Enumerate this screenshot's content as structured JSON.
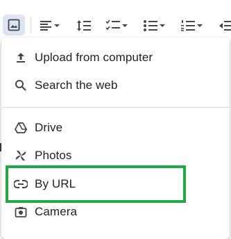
{
  "toolbar": {
    "items": [
      {
        "icon": "insert-image-icon"
      },
      {
        "icon": "align-left-icon"
      },
      {
        "icon": "line-spacing-icon"
      },
      {
        "icon": "checklist-icon"
      },
      {
        "icon": "bulleted-list-icon"
      },
      {
        "icon": "numbered-list-icon"
      },
      {
        "icon": "decrease-indent-icon"
      }
    ]
  },
  "menu": {
    "items": [
      {
        "label": "Upload from computer",
        "icon": "upload-icon"
      },
      {
        "label": "Search the web",
        "icon": "search-icon"
      },
      {
        "label": "Drive",
        "icon": "drive-icon"
      },
      {
        "label": "Photos",
        "icon": "photos-pinwheel-icon"
      },
      {
        "label": "By URL",
        "icon": "link-icon",
        "highlighted": true
      },
      {
        "label": "Camera",
        "icon": "camera-icon"
      }
    ]
  },
  "colors": {
    "highlight_border": "#22a845",
    "active_button_bg": "#dbe4f3",
    "text": "#202124",
    "icon": "#444746"
  }
}
